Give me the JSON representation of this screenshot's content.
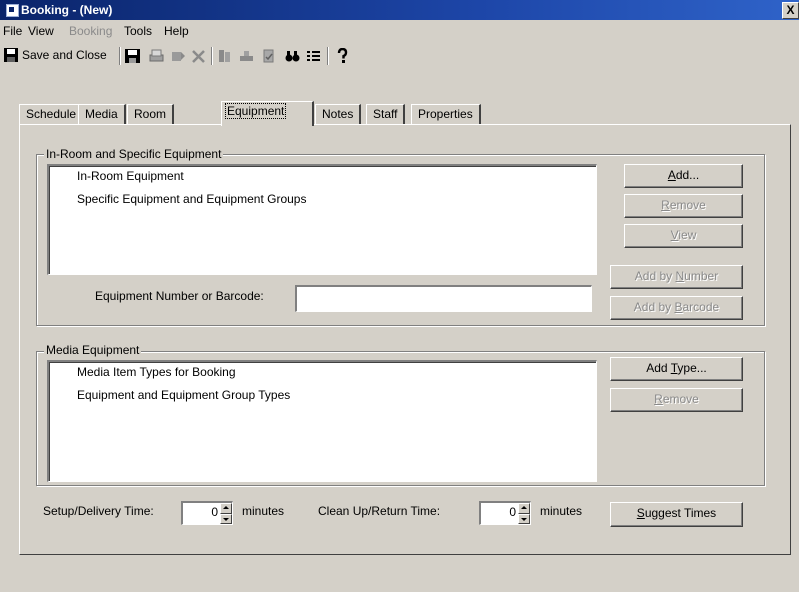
{
  "window": {
    "title": "Booking - (New)",
    "close_glyph": "X"
  },
  "menu": [
    {
      "label": "File",
      "enabled": true
    },
    {
      "label": "View",
      "enabled": true
    },
    {
      "label": "Booking",
      "enabled": false
    },
    {
      "label": "Tools",
      "enabled": true
    },
    {
      "label": "Help",
      "enabled": true
    }
  ],
  "toolbar": {
    "save_close_label": "Save and Close",
    "icons": [
      "save-icon",
      "print-icon",
      "copy-icon",
      "delete-icon",
      "book-icon",
      "checkout-icon",
      "clipboard-icon",
      "find-icon",
      "list-icon",
      "help-icon"
    ]
  },
  "tabs": [
    {
      "label": "Schedule",
      "active": false
    },
    {
      "label": "Media",
      "active": false
    },
    {
      "label": "Room",
      "active": false
    },
    {
      "label": "Equipment",
      "active": true
    },
    {
      "label": "Notes",
      "active": false
    },
    {
      "label": "Staff",
      "active": false
    },
    {
      "label": "Properties",
      "active": false
    }
  ],
  "in_room": {
    "group_label": "In-Room and Specific Equipment",
    "items": [
      "In-Room Equipment",
      "Specific Equipment and Equipment Groups"
    ],
    "buttons": {
      "add": {
        "pre": "",
        "key": "A",
        "post": "dd..."
      },
      "remove": {
        "pre": "",
        "key": "R",
        "post": "emove"
      },
      "view": {
        "pre": "",
        "key": "V",
        "post": "iew"
      },
      "add_by_number": {
        "pre": "Add by ",
        "key": "N",
        "post": "umber"
      },
      "add_by_barcode": {
        "pre": "Add by ",
        "key": "B",
        "post": "arcode"
      }
    },
    "barcode_label": "Equipment Number or Barcode:",
    "barcode_value": ""
  },
  "media": {
    "group_label": "Media Equipment",
    "items": [
      "Media Item Types for Booking",
      "Equipment and Equipment Group Types"
    ],
    "buttons": {
      "add_type": {
        "pre": "Add ",
        "key": "T",
        "post": "ype..."
      },
      "remove": {
        "pre": "",
        "key": "R",
        "post": "emove"
      }
    }
  },
  "times": {
    "setup_label": "Setup/Delivery Time:",
    "setup_value": "0",
    "setup_unit": "minutes",
    "cleanup_label": "Clean Up/Return Time:",
    "cleanup_value": "0",
    "cleanup_unit": "minutes",
    "suggest": {
      "pre": "",
      "key": "S",
      "post": "uggest Times"
    }
  }
}
